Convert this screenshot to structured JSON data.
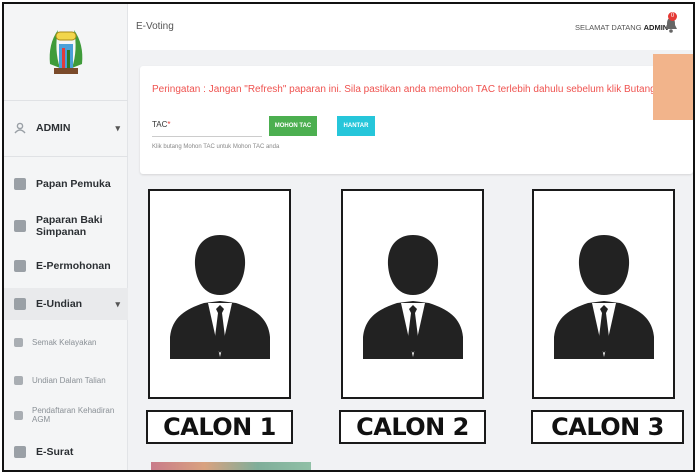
{
  "header": {
    "title": "E-Voting",
    "greeting_prefix": "SELAMAT DATANG",
    "user": "ADMIN",
    "notification_count": "0"
  },
  "sidebar": {
    "user_label": "ADMIN",
    "items": [
      {
        "label": "Papan Pemuka",
        "icon": "dashboard-icon"
      },
      {
        "label": "Paparan Baki Simpanan",
        "icon": "document-icon"
      },
      {
        "label": "E-Permohonan",
        "icon": "grid-icon"
      },
      {
        "label": "E-Undian",
        "icon": "ballot-icon"
      },
      {
        "label": "Semak Kelayakan",
        "icon": "check-icon"
      },
      {
        "label": "Undian Dalam Talian",
        "icon": "vote-icon"
      },
      {
        "label": "Pendaftaran Kehadiran AGM",
        "icon": "register-icon"
      },
      {
        "label": "E-Surat",
        "icon": "mail-icon"
      }
    ]
  },
  "alert": {
    "warning": "Peringatan : Jangan \"Refresh\" paparan ini. Sila pastikan anda memohon TAC terlebih dahulu sebelum klik Butang Hantar",
    "tac_label": "TAC",
    "tac_required_mark": "*",
    "hint": "Klik butang Mohon TAC untuk Mohon TAC anda",
    "mohon_tac_label": "MOHON TAC",
    "hantar_label": "HANTAR"
  },
  "candidates": [
    {
      "label": "CALON 1"
    },
    {
      "label": "CALON 2"
    },
    {
      "label": "CALON 3"
    }
  ],
  "colors": {
    "warning": "#ef5350",
    "mohon_tac": "#4caf50",
    "hantar": "#26c6da",
    "accent_box": "#f2b48b"
  }
}
